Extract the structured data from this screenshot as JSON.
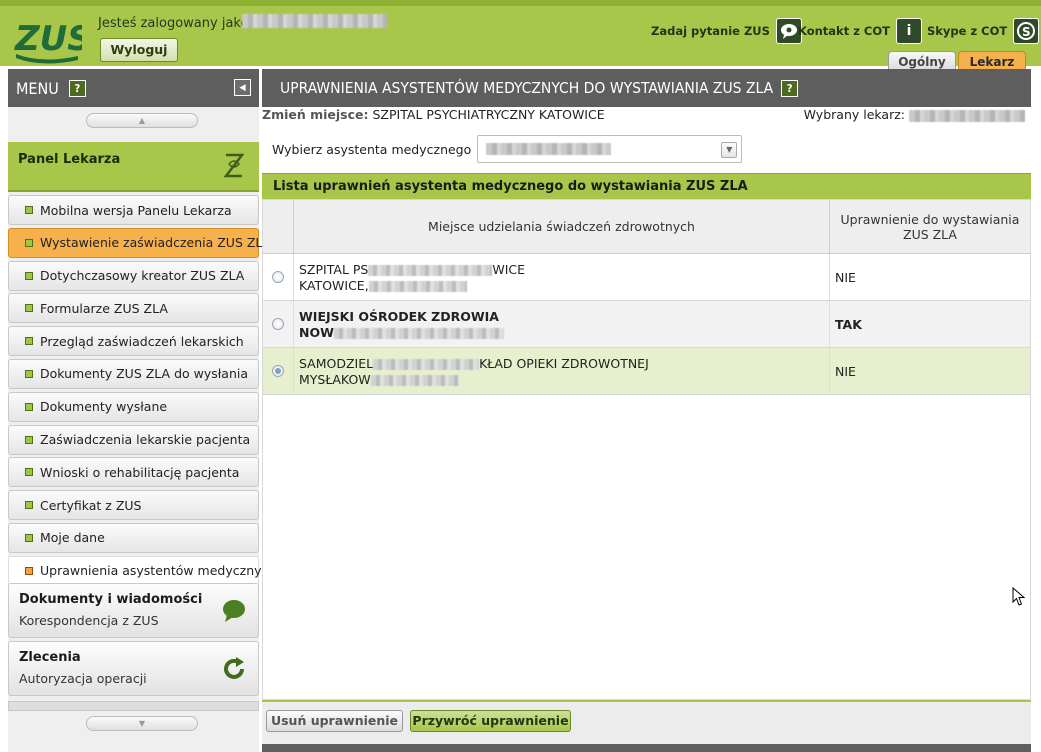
{
  "header": {
    "logo_text": "ZUS",
    "login_label": "Jesteś zalogowany jako:",
    "logout_label": "Wyloguj",
    "links": [
      {
        "label": "Zadaj pytanie ZUS",
        "icon": "chat-question-icon"
      },
      {
        "label": "Kontakt z COT",
        "icon": "info-icon"
      },
      {
        "label": "Skype z COT",
        "icon": "skype-icon"
      }
    ],
    "tabs": [
      {
        "label": "Ogólny",
        "active": false
      },
      {
        "label": "Lekarz",
        "active": true
      }
    ]
  },
  "sidebar": {
    "menu_title": "MENU",
    "help_glyph": "?",
    "panel_title": "Panel Lekarza",
    "items": [
      {
        "label": "Mobilna wersja Panelu Lekarza"
      },
      {
        "label": "Wystawienie zaświadczenia ZUS ZLA"
      },
      {
        "label": "Dotychczasowy kreator ZUS ZLA"
      },
      {
        "label": "Formularze ZUS ZLA"
      },
      {
        "label": "Przegląd zaświadczeń lekarskich"
      },
      {
        "label": "Dokumenty ZUS ZLA do wysłania"
      },
      {
        "label": "Dokumenty wysłane"
      },
      {
        "label": "Zaświadczenia lekarskie pacjenta"
      },
      {
        "label": "Wnioski o rehabilitację pacjenta"
      },
      {
        "label": "Certyfikat z ZUS"
      },
      {
        "label": "Moje dane"
      },
      {
        "label": "Uprawnienia asystentów medycznych"
      }
    ],
    "sections": [
      {
        "title": "Dokumenty i wiadomości",
        "subtitle": "Korespondencja z ZUS"
      },
      {
        "title": "Zlecenia",
        "subtitle": "Autoryzacja operacji"
      }
    ]
  },
  "main": {
    "title": "UPRAWNIENIA ASYSTENTÓW MEDYCZNYCH DO WYSTAWIANIA ZUS ZLA",
    "place_label": "Zmień miejsce:",
    "place_value": "SZPITAL PSYCHIATRYCZNY KATOWICE",
    "doctor_label": "Wybrany lekarz:",
    "assistant_label": "Wybierz asystenta medycznego",
    "list_title": "Lista uprawnień asystenta medycznego do wystawiania ZUS ZLA",
    "columns": {
      "place": "Miejsce udzielania świadczeń zdrowotnych",
      "permission": "Uprawnienie do wystawiania ZUS ZLA"
    },
    "rows": [
      {
        "line1_start": "SZPITAL PS",
        "line1_end": "WICE",
        "line2_start": "KATOWICE,",
        "permission": "NIE",
        "bold": false,
        "selected": false
      },
      {
        "line1_start": "WIEJSKI OŚRODEK ZDROWIA",
        "line1_end": "",
        "line2_start": "NOW",
        "permission": "TAK",
        "bold": true,
        "selected": false
      },
      {
        "line1_start": "SAMODZIEL",
        "line1_end": "KŁAD OPIEKI ZDROWOTNEJ",
        "line2_start": "MYSŁAKOW",
        "permission": "NIE",
        "bold": false,
        "selected": true
      }
    ],
    "buttons": {
      "remove": "Usuń uprawnienie",
      "restore": "Przywróć uprawnienie"
    }
  }
}
